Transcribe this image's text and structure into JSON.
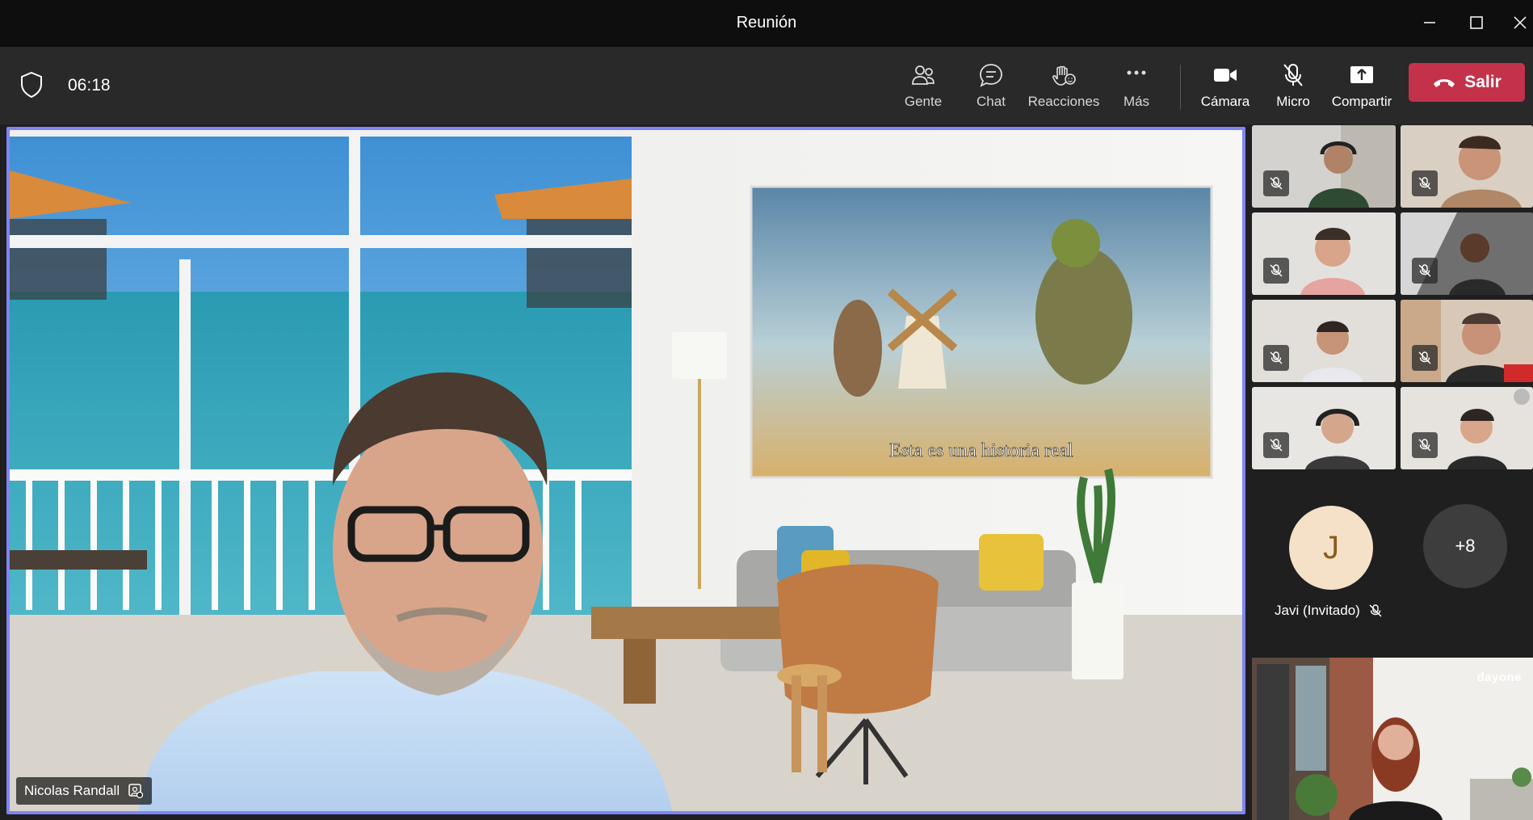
{
  "window": {
    "title": "Reunión"
  },
  "toolbar": {
    "timer": "06:18",
    "people_label": "Gente",
    "chat_label": "Chat",
    "reactions_label": "Reacciones",
    "more_label": "Más",
    "camera_label": "Cámara",
    "mic_label": "Micro",
    "share_label": "Compartir",
    "leave_label": "Salir"
  },
  "main_video": {
    "speaker_name": "Nicolas Randall",
    "slide_caption": "Esta es una historia real"
  },
  "participants": {
    "guest_initial": "J",
    "guest_name": "Javi (Invitado)",
    "overflow_count": "+8"
  },
  "presenter_tile": {
    "brand": "dayone"
  },
  "colors": {
    "accent": "#7f85f5",
    "leave": "#c4314b",
    "toolbar": "#292929",
    "titlebar": "#0e0e0e"
  }
}
